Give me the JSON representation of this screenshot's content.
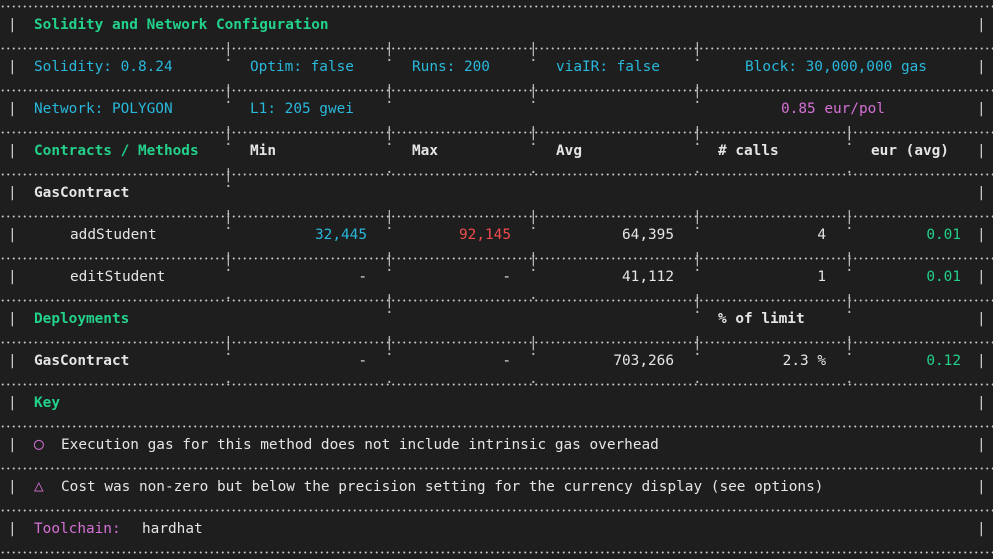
{
  "title": "Solidity and Network Configuration",
  "config": {
    "solidity": "Solidity: 0.8.24",
    "optim": "Optim: false",
    "runs": "Runs: 200",
    "viair": "viaIR: false",
    "block": "Block: 30,000,000 gas",
    "network": "Network: POLYGON",
    "l1": "L1: 205 gwei",
    "price": "0.85 eur/pol"
  },
  "headers": {
    "contracts_methods": "Contracts / Methods",
    "min": "Min",
    "max": "Max",
    "avg": "Avg",
    "calls": "# calls",
    "eur_avg": "eur (avg)"
  },
  "contract": {
    "name": "GasContract",
    "methods": [
      {
        "name": "addStudent",
        "min": "32,445",
        "max": "92,145",
        "avg": "64,395",
        "calls": "4",
        "eur": "0.01"
      },
      {
        "name": "editStudent",
        "min": "-",
        "max": "-",
        "avg": "41,112",
        "calls": "1",
        "eur": "0.01"
      }
    ]
  },
  "deployments": {
    "header": "Deployments",
    "limit_header": "% of limit",
    "rows": [
      {
        "name": "GasContract",
        "min": "-",
        "max": "-",
        "avg": "703,266",
        "limit": "2.3 %",
        "eur": "0.12"
      }
    ]
  },
  "key": {
    "header": "Key",
    "items": [
      {
        "symbol": "◯",
        "text": "Execution gas for this method does not include intrinsic gas overhead",
        "color": "#d670d6"
      },
      {
        "symbol": "△",
        "text": "Cost was non-zero but below the precision setting for the currency display (see options)",
        "color": "#d670d6"
      }
    ]
  },
  "toolchain": {
    "label": "Toolchain:",
    "value": "hardhat"
  }
}
